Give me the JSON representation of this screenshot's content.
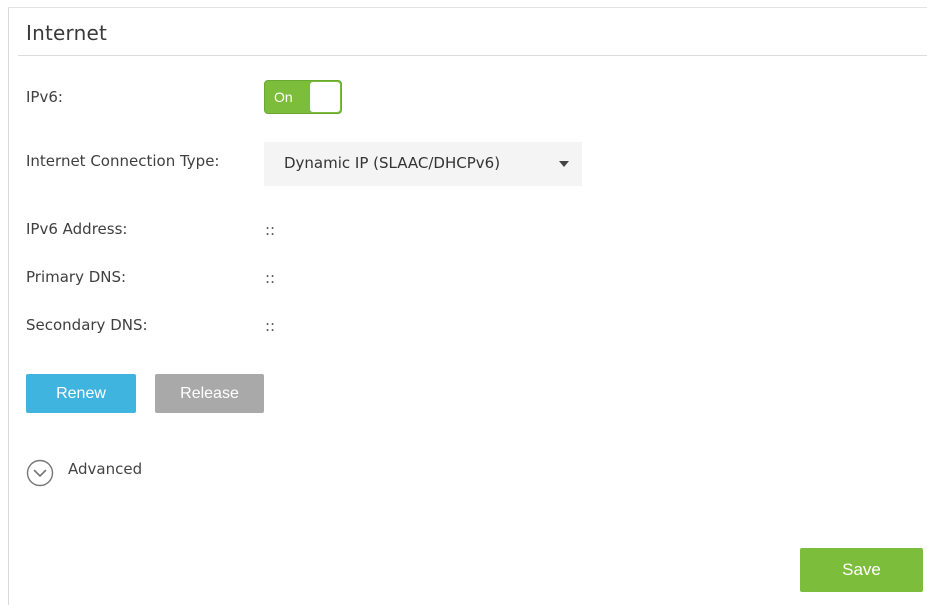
{
  "section": {
    "title": "Internet"
  },
  "ipv6": {
    "label": "IPv6:",
    "toggle_text": "On",
    "state": true
  },
  "connection_type": {
    "label": "Internet Connection Type:",
    "selected": "Dynamic IP (SLAAC/DHCPv6)"
  },
  "fields": [
    {
      "label": "IPv6 Address:",
      "value": "::"
    },
    {
      "label": "Primary DNS:",
      "value": "::"
    },
    {
      "label": "Secondary DNS:",
      "value": "::"
    }
  ],
  "buttons": {
    "renew": "Renew",
    "release": "Release",
    "save": "Save"
  },
  "advanced": {
    "label": "Advanced",
    "icon": "chevron-down-circle-icon"
  },
  "colors": {
    "accent_green": "#7dbd3c",
    "renew_blue": "#3fb4de",
    "release_gray": "#a9a9a9"
  }
}
